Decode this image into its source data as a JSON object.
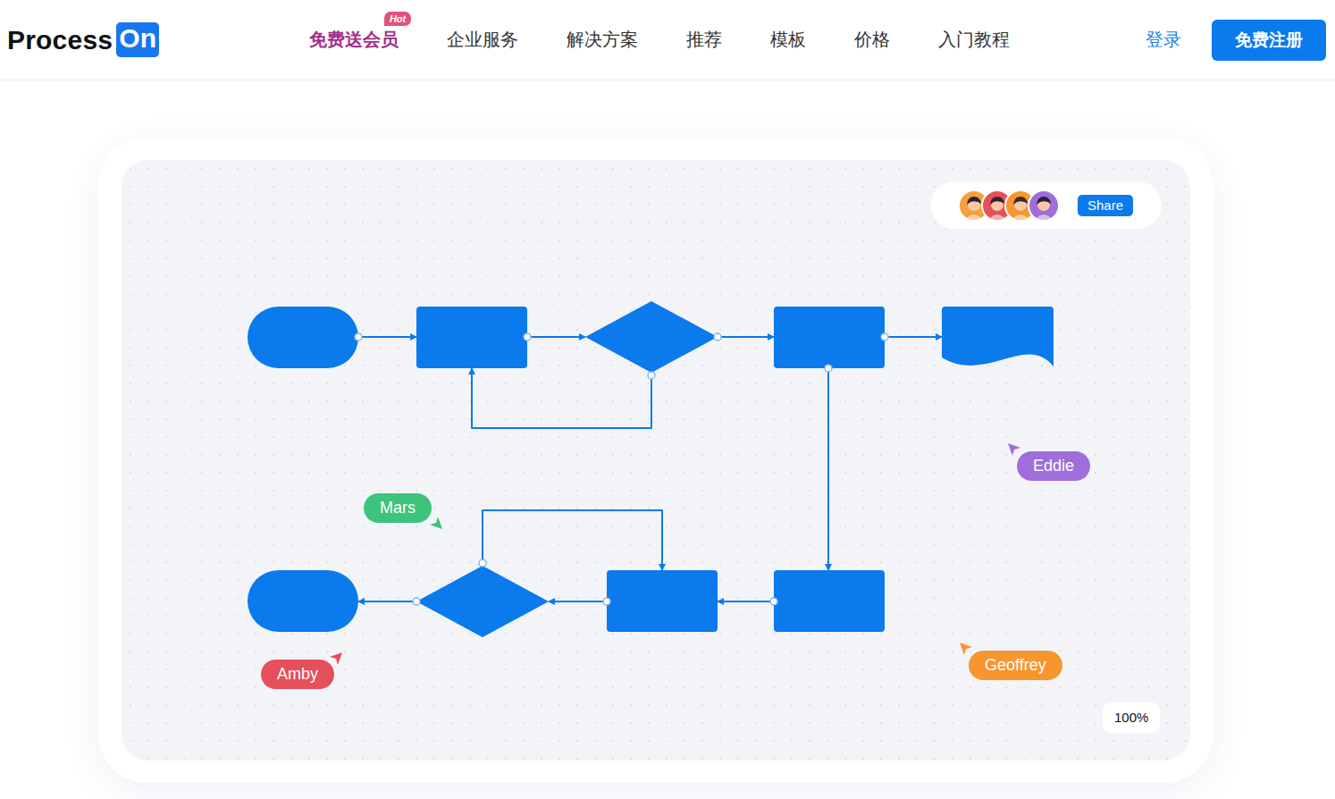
{
  "header": {
    "logo": {
      "text": "Process",
      "badge": "On"
    },
    "nav": [
      {
        "label": "免费送会员",
        "highlighted": true,
        "badge": "Hot"
      },
      {
        "label": "企业服务",
        "highlighted": false
      },
      {
        "label": "解决方案",
        "highlighted": false
      },
      {
        "label": "推荐",
        "highlighted": false
      },
      {
        "label": "模板",
        "highlighted": false
      },
      {
        "label": "价格",
        "highlighted": false
      },
      {
        "label": "入门教程",
        "highlighted": false
      }
    ],
    "login": "登录",
    "register": "免费注册"
  },
  "canvas": {
    "share_bar": {
      "avatars": [
        {
          "color": "#f5a03c"
        },
        {
          "color": "#e5505a"
        },
        {
          "color": "#f7952e"
        },
        {
          "color": "#a06ddb"
        }
      ],
      "button": "Share"
    },
    "diagram": {
      "nodes": [
        {
          "kind": "terminal"
        },
        {
          "kind": "process"
        },
        {
          "kind": "decision"
        },
        {
          "kind": "process"
        },
        {
          "kind": "document"
        },
        {
          "kind": "process"
        },
        {
          "kind": "process"
        },
        {
          "kind": "decision"
        },
        {
          "kind": "terminal"
        }
      ]
    },
    "cursors": [
      {
        "name": "Mars",
        "color": "#3cc47c"
      },
      {
        "name": "Eddie",
        "color": "#a06ddb"
      },
      {
        "name": "Amby",
        "color": "#e5505a"
      },
      {
        "name": "Geoffrey",
        "color": "#f7952e"
      }
    ],
    "zoom": "100%"
  }
}
